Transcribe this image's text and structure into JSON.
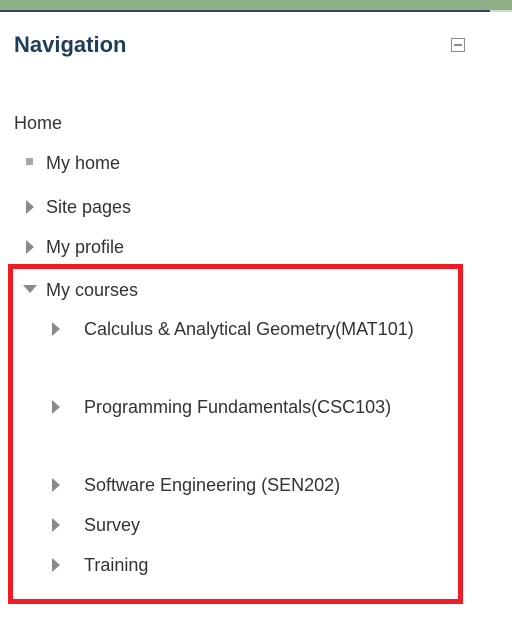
{
  "navigation": {
    "title": "Navigation",
    "home_label": "Home",
    "items": [
      {
        "label": "My home"
      },
      {
        "label": "Site pages"
      },
      {
        "label": "My profile"
      },
      {
        "label": "My courses"
      }
    ],
    "courses": [
      {
        "label": "Calculus & Analytical Geometry(MAT101)"
      },
      {
        "label": "Programming Fundamentals(CSC103)"
      },
      {
        "label": "Software Engineering (SEN202)"
      },
      {
        "label": "Survey"
      },
      {
        "label": "Training"
      }
    ]
  },
  "colors": {
    "title": "#1f3c5a",
    "text": "#333333",
    "highlight": "#ee1c24",
    "top_strip": "#8fb087"
  }
}
